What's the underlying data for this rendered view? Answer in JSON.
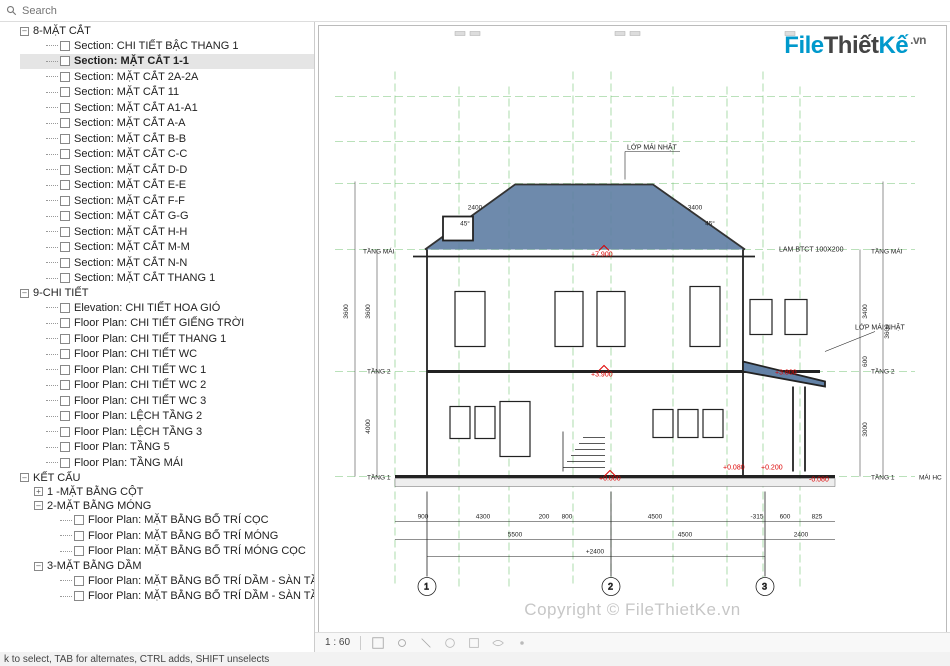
{
  "search": {
    "placeholder": "Search"
  },
  "logo": {
    "p1": "File",
    "p2": "Thiết",
    "p3": "Kế",
    "suffix": ".vn"
  },
  "watermark": "Copyright © FileThietKe.vn",
  "statusbar": {
    "hint": "k to select, TAB for alternates, CTRL adds, SHIFT unselects",
    "scale": "1 : 60"
  },
  "drawing": {
    "labels": {
      "roof1": "LỚP MÁI NHẬT",
      "roof2": "LỚP MÁI NHẬT",
      "lam": "LAM BTCT 100X200",
      "lvl_roof": "+7.900",
      "lvl_2": "+3.900",
      "lvl_2b": "+3.800",
      "lvl_g": "+0.000",
      "lvl_gb1": "+0.080",
      "lvl_gb2": "+0.200",
      "lvl_gneg": "-0.080",
      "tang_mai": "TẦNG MÁI",
      "tang_2": "TẦNG 2",
      "tang_1": "TẦNG 1",
      "axis1": "1",
      "axis2": "2",
      "axis3": "3",
      "dim_total": "+2400",
      "d1": "5500",
      "d2": "4500",
      "d3": "2400",
      "da": "900",
      "db": "4300",
      "dc": "200",
      "dd": "800",
      "de": "4500",
      "df": "-315",
      "dg": "600",
      "dh": "825",
      "h1": "3600",
      "h2": "4000",
      "h3": "3600",
      "h4": "3000",
      "roof_dim": "2400",
      "roof_dim2": "3400",
      "roof_ang": "45°",
      "roof_ang2": "45°",
      "hr1": "3400",
      "hr2": "600",
      "hr3": "600",
      "hr4": "3600"
    }
  },
  "tree": [
    {
      "name": "8-MẶT CẮT",
      "expanded": true,
      "items": [
        {
          "label": "Section: CHI TIẾT BẬC THANG 1"
        },
        {
          "label": "Section: MẶT CẮT 1-1",
          "selected": true
        },
        {
          "label": "Section: MẶT CẮT 2A-2A"
        },
        {
          "label": "Section: MẶT CẮT 11"
        },
        {
          "label": "Section: MẶT CẮT A1-A1"
        },
        {
          "label": "Section: MẶT CẮT A-A"
        },
        {
          "label": "Section: MẶT CẮT B-B"
        },
        {
          "label": "Section: MẶT CẮT C-C"
        },
        {
          "label": "Section: MẶT CẮT D-D"
        },
        {
          "label": "Section: MẶT CẮT E-E"
        },
        {
          "label": "Section: MẶT CẮT F-F"
        },
        {
          "label": "Section: MẶT CẮT G-G"
        },
        {
          "label": "Section: MẶT CẮT H-H"
        },
        {
          "label": "Section: MẶT CẮT M-M"
        },
        {
          "label": "Section: MẶT CẮT N-N"
        },
        {
          "label": "Section: MẶT CẮT THANG 1"
        }
      ]
    },
    {
      "name": "9-CHI TIẾT",
      "expanded": true,
      "items": [
        {
          "label": "Elevation: CHI TIẾT HOA GIÓ"
        },
        {
          "label": "Floor Plan: CHI TIẾT GIẾNG TRỜI"
        },
        {
          "label": "Floor Plan: CHI TIẾT THANG 1"
        },
        {
          "label": "Floor Plan: CHI TIẾT WC"
        },
        {
          "label": "Floor Plan: CHI TIẾT WC 1"
        },
        {
          "label": "Floor Plan: CHI TIẾT WC 2"
        },
        {
          "label": "Floor Plan: CHI TIẾT WC 3"
        },
        {
          "label": "Floor Plan: LỆCH TẦNG 2"
        },
        {
          "label": "Floor Plan: LỆCH TẦNG 3"
        },
        {
          "label": "Floor Plan: TẦNG 5"
        },
        {
          "label": "Floor Plan: TẦNG MÁI"
        }
      ]
    },
    {
      "name": "KẾT CẤU",
      "expanded": true,
      "items": []
    },
    {
      "name": "1 -MẶT BẰNG CỘT",
      "expanded": false,
      "nested": true,
      "items": []
    },
    {
      "name": "2-MẶT BẰNG MÓNG",
      "expanded": true,
      "nested": true,
      "items": [
        {
          "label": "Floor Plan: MẶT BẰNG BỐ TRÍ CỌC"
        },
        {
          "label": "Floor Plan: MẶT BẰNG BỐ TRÍ MÓNG"
        },
        {
          "label": "Floor Plan: MẶT BẰNG BỐ TRÍ MÓNG CỌC"
        }
      ]
    },
    {
      "name": "3-MẶT BẰNG DẦM",
      "expanded": true,
      "nested": true,
      "items": [
        {
          "label": "Floor Plan: MẶT BẰNG BỐ TRÍ DẦM - SÀN TẦNG ĐỈNH"
        },
        {
          "label": "Floor Plan: MẶT BẰNG BỐ TRÍ DẦM - SÀN TẦNG ĐỈNH"
        }
      ]
    }
  ]
}
